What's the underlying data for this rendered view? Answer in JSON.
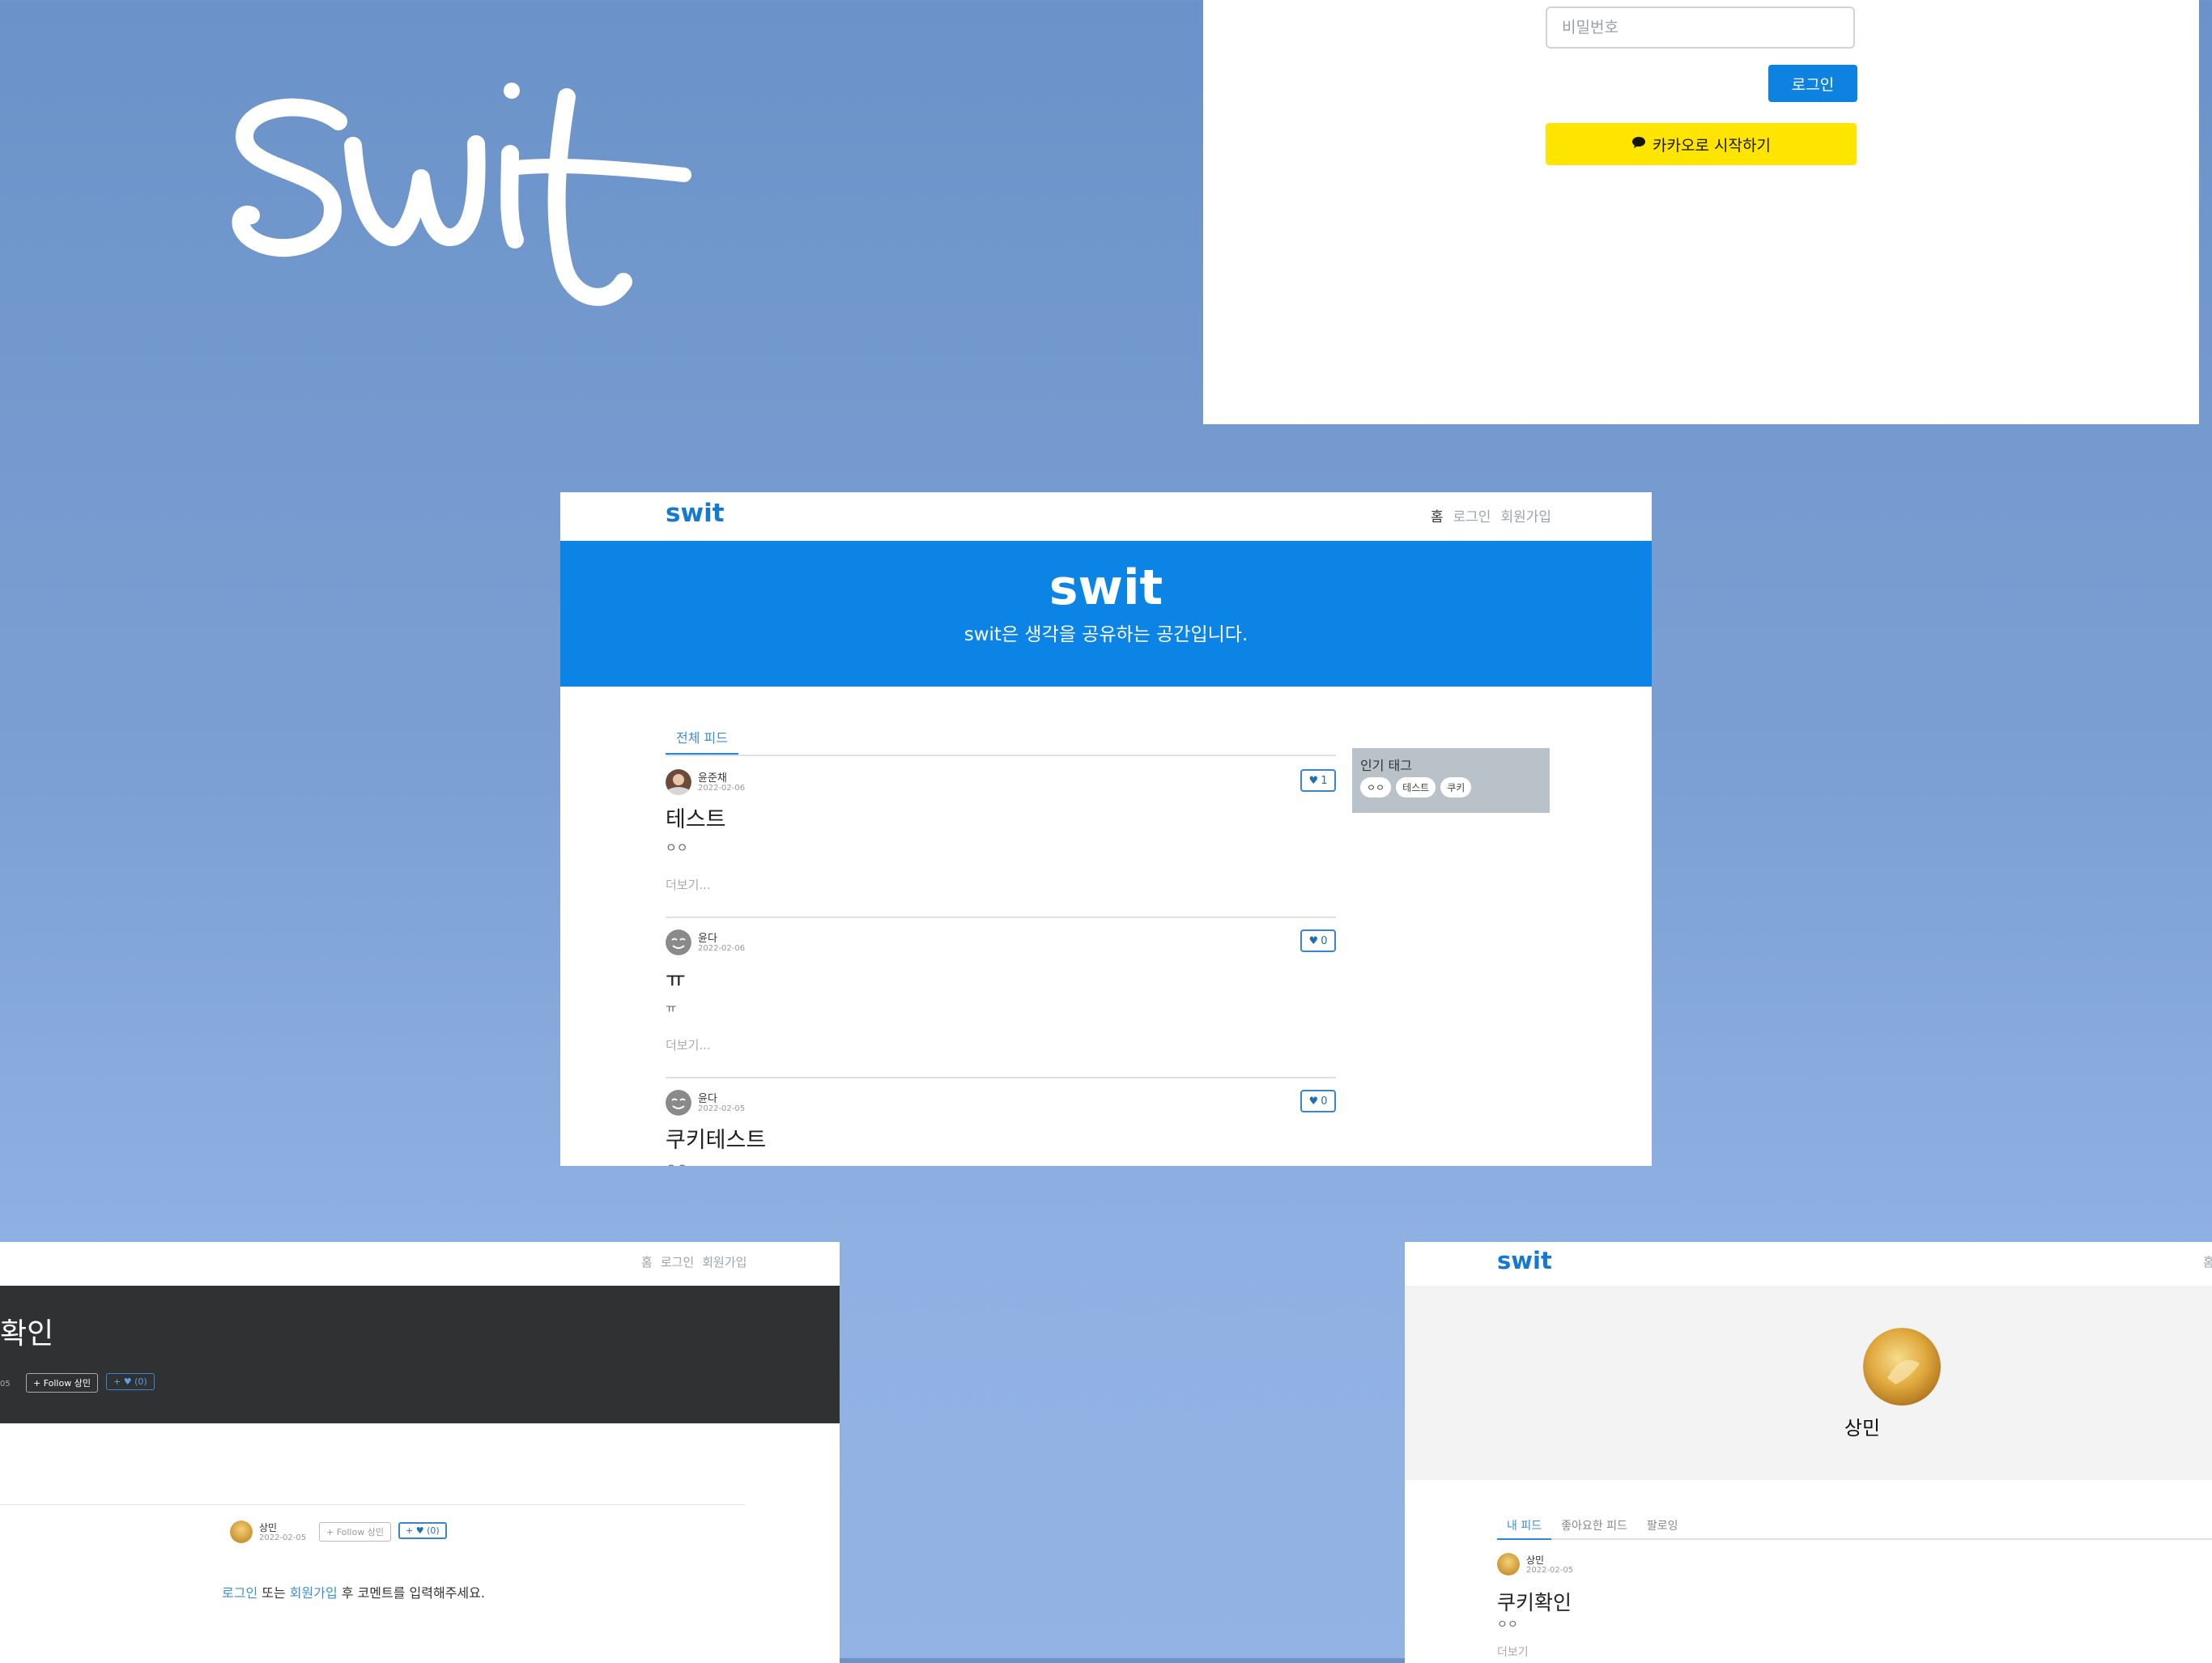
{
  "hero_logo": "swit",
  "login": {
    "password_placeholder": "비밀번호",
    "login_label": "로그인",
    "kakao_label": "카카오로 시작하기"
  },
  "main": {
    "brand": "swit",
    "nav": {
      "home": "홈",
      "login": "로그인",
      "signup": "회원가입"
    },
    "hero_title": "swit",
    "hero_sub": "swit은 생각을 공유하는 공간입니다.",
    "tab_all": "전체 피드",
    "more_label": "더보기...",
    "posts": [
      {
        "author": "윤준채",
        "date": "2022-02-06",
        "likes": "1",
        "title": "테스트",
        "body": "ㅇㅇ"
      },
      {
        "author": "윤다",
        "date": "2022-02-06",
        "likes": "0",
        "title": "ㅠ",
        "body": "ㅠ"
      },
      {
        "author": "윤다",
        "date": "2022-02-05",
        "likes": "0",
        "title": "쿠키테스트",
        "body": "ㅇㅇ"
      }
    ],
    "tags_title": "인기 태그",
    "tags": [
      "ㅇㅇ",
      "테스트",
      "쿠키"
    ]
  },
  "detail": {
    "nav": {
      "home": "홈",
      "login": "로그인",
      "signup": "회원가입"
    },
    "title": "확인",
    "date_fragment": "05",
    "follow_label": "+ Follow 상민",
    "like_label": "+ ♥ (0)",
    "author": "상민",
    "date": "2022-02-05",
    "comment_login": "로그인",
    "comment_or": " 또는 ",
    "comment_signup": "회원가입",
    "comment_rest": " 후 코멘트를 입력해주세요."
  },
  "profile": {
    "brand": "swit",
    "home": "홈",
    "name": "상민",
    "tabs": [
      "내 피드",
      "좋아요한 피드",
      "팔로잉"
    ],
    "post": {
      "author": "상민",
      "date": "2022-02-05",
      "title": "쿠키확인",
      "body": "ㅇㅇ",
      "more": "더보기"
    }
  },
  "colors": {
    "primary": "#0b84e6",
    "brand": "#1579d1",
    "kakao": "#fee500",
    "dark": "#303133"
  }
}
